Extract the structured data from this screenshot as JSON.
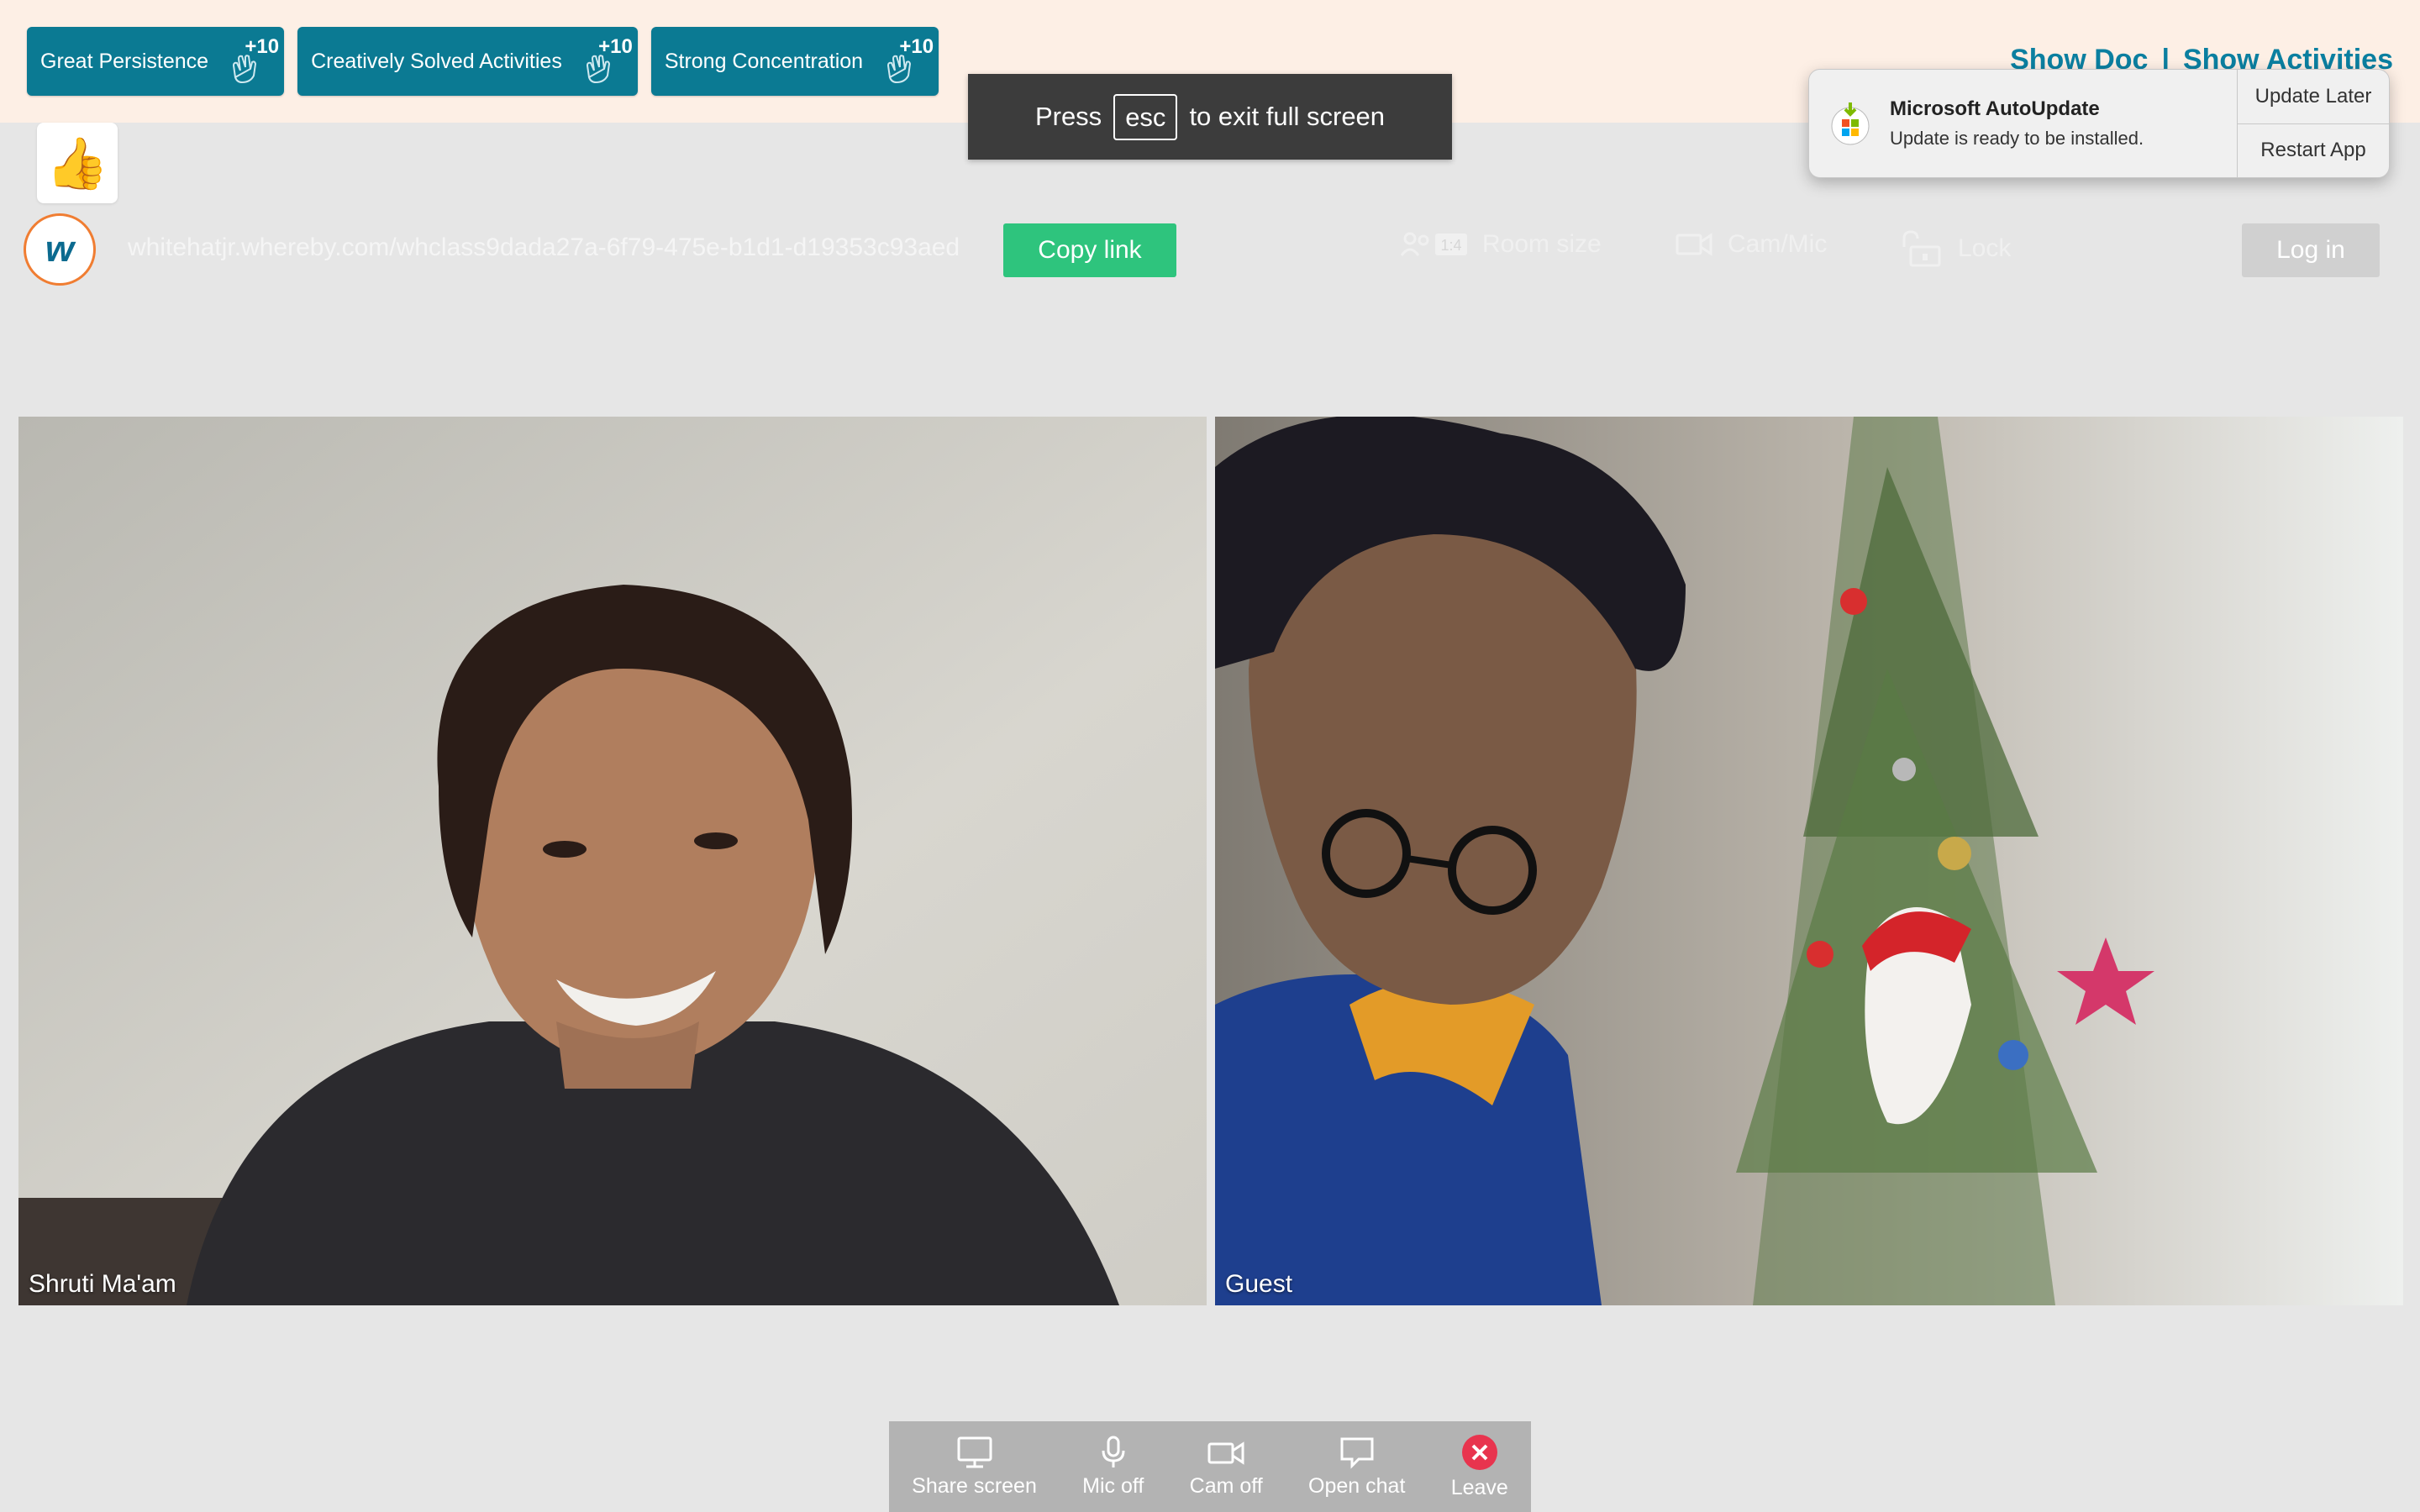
{
  "badges": [
    {
      "label": "Great Persistence",
      "points": "+10"
    },
    {
      "label": "Creatively Solved Activities",
      "points": "+10"
    },
    {
      "label": "Strong Concentration",
      "points": "+10"
    }
  ],
  "top_links": {
    "show_doc": "Show Doc",
    "separator": "|",
    "show_activities": "Show Activities"
  },
  "reaction": {
    "emoji": "👍"
  },
  "fullscreen_notice": {
    "press": "Press",
    "key": "esc",
    "suffix": "to exit full screen"
  },
  "notification": {
    "title": "Microsoft AutoUpdate",
    "message": "Update is ready to be installed.",
    "update_later": "Update Later",
    "restart_app": "Restart App"
  },
  "room": {
    "logo_letter": "w",
    "url": "whitehatjr.whereby.com/whclass9dada27a-6f79-475e-b1d1-d19353c93aed",
    "copy_link": "Copy link",
    "room_size_badge": "1:4",
    "room_size": "Room size",
    "cam_mic": "Cam/Mic",
    "lock": "Lock",
    "login": "Log in"
  },
  "participants": [
    {
      "name": "Shruti Ma'am"
    },
    {
      "name": "Guest"
    }
  ],
  "toolbar": {
    "share_screen": "Share screen",
    "mic_off": "Mic off",
    "cam_off": "Cam off",
    "open_chat": "Open chat",
    "leave": "Leave"
  },
  "colors": {
    "badge_bg": "#0b7a93",
    "top_strip": "#fdefe5",
    "copy_btn": "#2ec47d",
    "leave_red": "#e8344e",
    "link_blue": "#0b7fa0"
  }
}
